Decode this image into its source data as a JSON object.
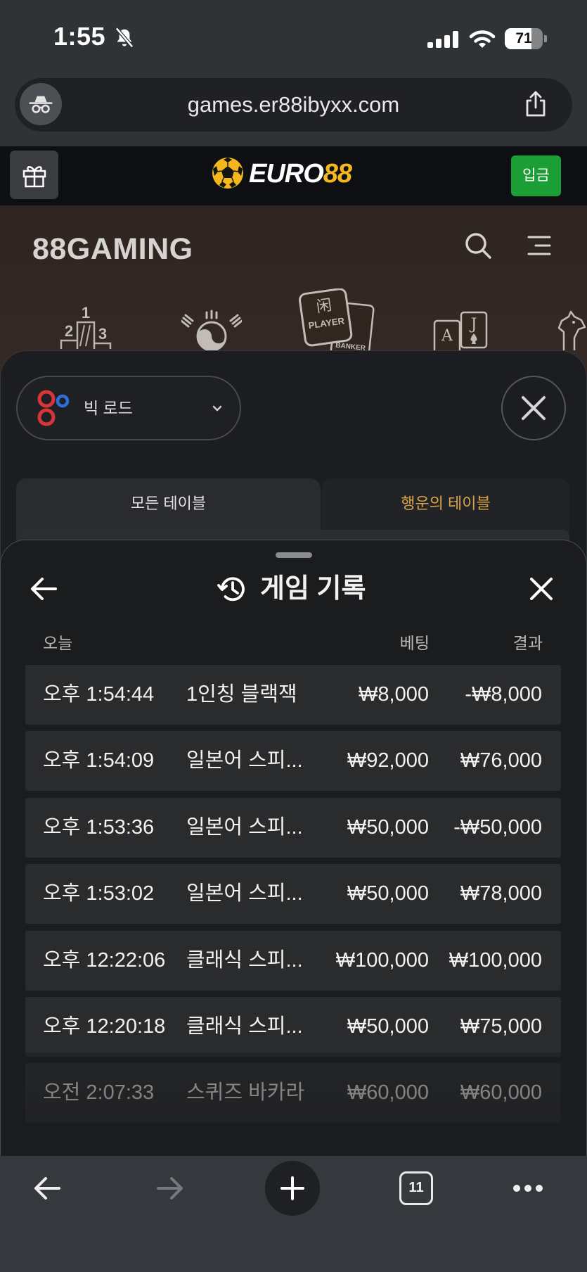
{
  "status_bar": {
    "time": "1:55",
    "battery_level": "71"
  },
  "browser": {
    "url": "games.er88ibyxx.com",
    "tab_count": "11",
    "icons": [
      "incognito-icon",
      "share-icon",
      "arrow-left-icon",
      "arrow-right-icon",
      "plus-icon",
      "tabs-icon",
      "more-icon"
    ]
  },
  "site_header": {
    "logo_main": "EURO",
    "logo_accent": "88",
    "deposit_label": "입금"
  },
  "gaming": {
    "logo_digits": "88",
    "logo_word": "GAMING",
    "categories": {
      "ranking": [
        "1",
        "2",
        "3"
      ],
      "baccarat": {
        "player_glyph": "闲",
        "player_label": "PLAYER",
        "banker_label": "BANKER"
      },
      "blackjack": [
        "A",
        "J"
      ]
    }
  },
  "table_filter": {
    "road_label": "빅 로드",
    "tabs": [
      {
        "label": "모든 테이블"
      },
      {
        "label": "행운의 테이블"
      }
    ]
  },
  "history": {
    "title": "게임 기록",
    "columns": {
      "day": "오늘",
      "bet": "베팅",
      "result": "결과"
    },
    "rows": [
      {
        "time": "오후 1:54:44",
        "game": "1인칭 블랙잭",
        "bet": "₩8,000",
        "result": "-₩8,000"
      },
      {
        "time": "오후 1:54:09",
        "game": "일본어 스피...",
        "bet": "₩92,000",
        "result": "₩76,000"
      },
      {
        "time": "오후 1:53:36",
        "game": "일본어 스피...",
        "bet": "₩50,000",
        "result": "-₩50,000"
      },
      {
        "time": "오후 1:53:02",
        "game": "일본어 스피...",
        "bet": "₩50,000",
        "result": "₩78,000"
      },
      {
        "time": "오후 12:22:06",
        "game": "클래식 스피...",
        "bet": "₩100,000",
        "result": "₩100,000"
      },
      {
        "time": "오후 12:20:18",
        "game": "클래식 스피...",
        "bet": "₩50,000",
        "result": "₩75,000"
      },
      {
        "time": "오전 2:07:33",
        "game": "스퀴즈 바카라",
        "bet": "₩60,000",
        "result": "₩60,000"
      }
    ]
  },
  "colors": {
    "brand_gold": "#f5b81c",
    "deposit_green": "#1b9e35",
    "lucky_tab_text": "#d7a548",
    "road_red": "#d8353b",
    "road_blue": "#2d6fd8"
  }
}
